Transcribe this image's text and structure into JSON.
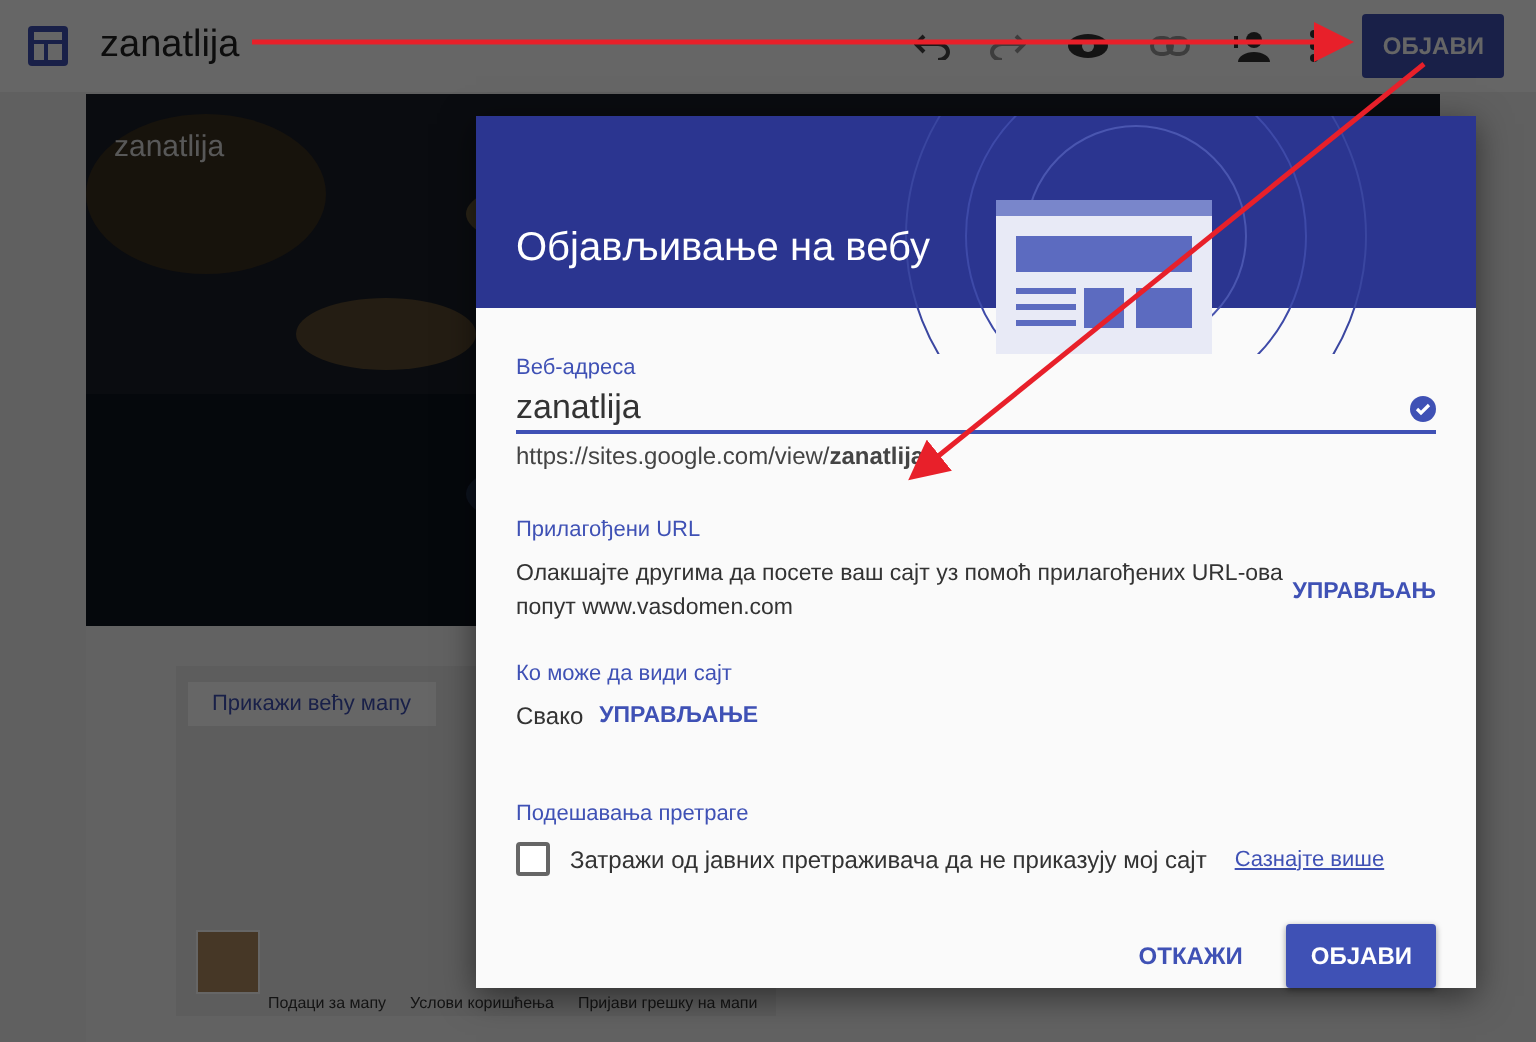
{
  "topbar": {
    "site_name": "zanatlija",
    "publish_button": "ОБЈАВИ"
  },
  "page": {
    "header_title": "zanatlija",
    "map": {
      "button": "Прикажи већу мапу",
      "footer": [
        "Подаци за мапу",
        "Услови коришћења",
        "Пријави грешку на мапи"
      ]
    }
  },
  "dialog": {
    "title": "Објављивање на вебу",
    "web_address": {
      "label": "Веб-адреса",
      "value": "zanatlija",
      "url": "https://sites.google.com/view/**zanatlija**",
      "verified": true
    },
    "custom_url": {
      "label": "Прилагођени URL",
      "description": "Олакшајте другима да посете ваш сајт уз помоћ прилагођених URL-ова попут www.vasdomen.com",
      "action": "УПРАВЉАЊ"
    },
    "visibility": {
      "label": "Ко може да види сајт",
      "value": "Свако",
      "action": "УПРАВЉАЊЕ"
    },
    "search": {
      "label": "Подешавања претраге",
      "checkbox": {
        "label": "Затражи од јавних претраживача да не приказују мој сајт",
        "checked": false
      },
      "link": "Сазнајте више"
    },
    "buttons": {
      "cancel": "ОТКАЖИ",
      "publish": "ОБЈАВИ"
    }
  }
}
